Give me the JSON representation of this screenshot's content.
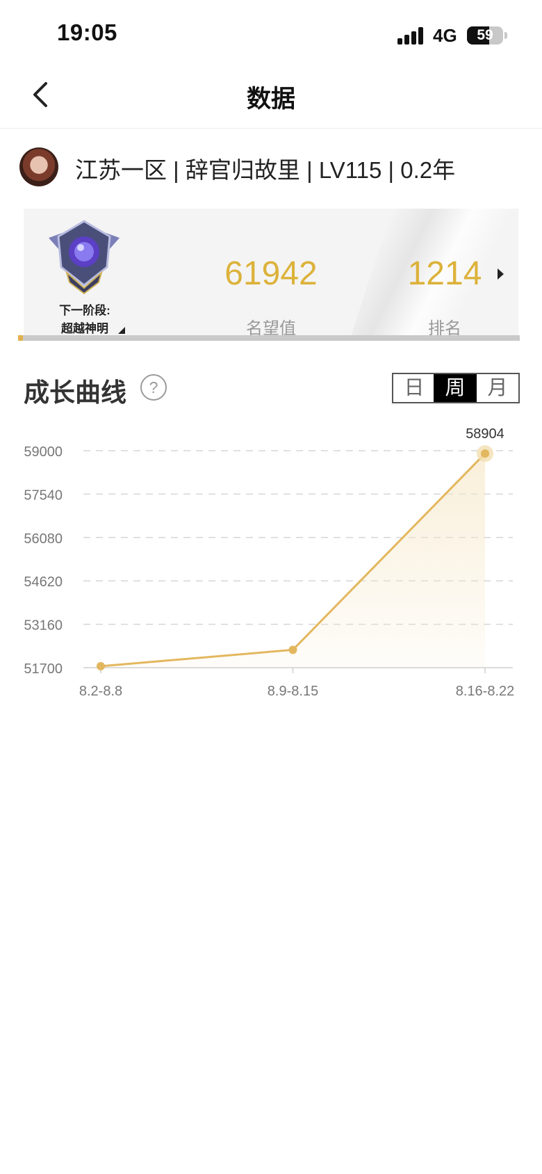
{
  "status_bar": {
    "time": "19:05",
    "network": "4G",
    "battery": "59"
  },
  "nav": {
    "title": "数据",
    "back_icon": "chevron-left-icon"
  },
  "profile": {
    "summary": "江苏一区 | 辞官归故里 | LV115 | 0.2年"
  },
  "stats": {
    "next_stage_label": "下一阶段:",
    "next_stage_value": "超越神明",
    "fame_value": "61942",
    "fame_label": "名望值",
    "rank_value": "1214",
    "rank_label": "排名",
    "progress_fraction": 0.01
  },
  "growth": {
    "title": "成长曲线",
    "help": "?",
    "periods": [
      "日",
      "周",
      "月"
    ],
    "selected_period": "周"
  },
  "colors": {
    "accent": "#dcb23a",
    "line": "#e3b75e",
    "text_muted": "#999999"
  },
  "chart_data": {
    "type": "line",
    "categories": [
      "8.2-8.8",
      "8.9-8.15",
      "8.16-8.22"
    ],
    "values": [
      51750,
      52300,
      58904
    ],
    "yticks": [
      59000,
      57540,
      56080,
      54620,
      53160,
      51700
    ],
    "ylim": [
      51700,
      59000
    ],
    "last_label": "58904",
    "grid": true
  }
}
